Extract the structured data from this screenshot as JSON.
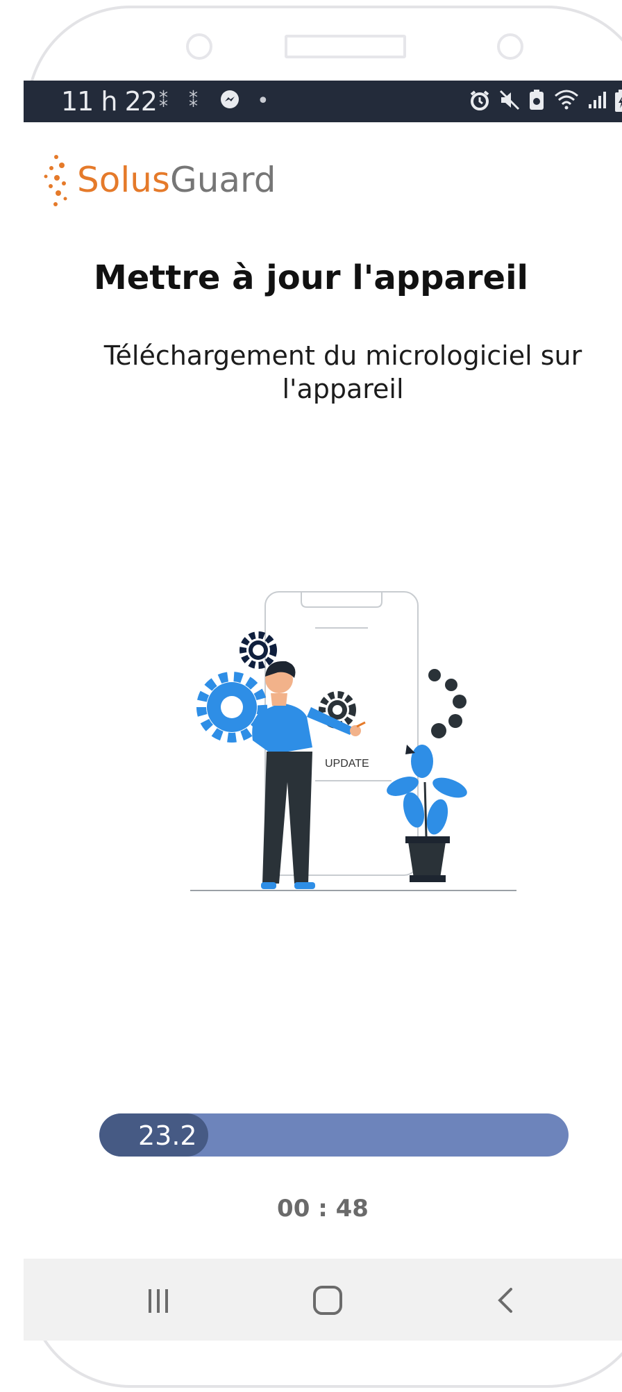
{
  "status_bar": {
    "time": "11 h 22",
    "icons": [
      "notification-icon",
      "notification-icon",
      "messenger-icon",
      "dot-icon",
      "alarm-icon",
      "mute-icon",
      "battery-saver-icon",
      "wifi-icon",
      "signal-icon",
      "battery-icon"
    ]
  },
  "brand": {
    "logo_part1": "Solus",
    "logo_part2": "Guard",
    "accent_color": "#e57a2a"
  },
  "page": {
    "title": "Mettre à jour l'appareil",
    "subtitle": "Téléchargement du micrologiciel sur l'appareil"
  },
  "illustration": {
    "phone_label": "UPDATE"
  },
  "progress": {
    "value_text": "23.2",
    "percent": 23.2,
    "fill_color": "#465a84",
    "track_color": "#6d84bb"
  },
  "timer": {
    "text": "00 : 48"
  },
  "nav_bar": {
    "buttons": [
      "recent-apps-icon",
      "home-icon",
      "back-icon"
    ]
  }
}
